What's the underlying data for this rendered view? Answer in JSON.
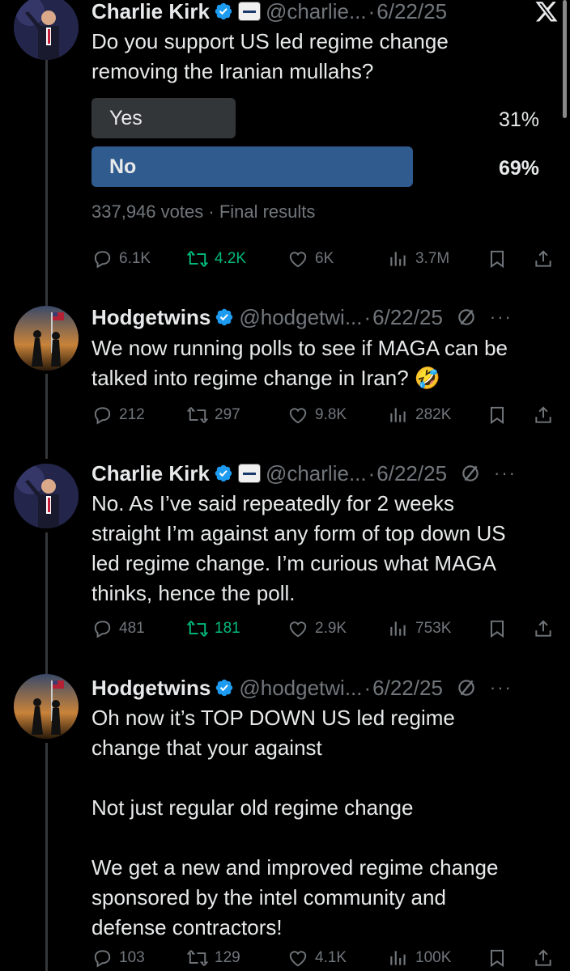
{
  "tweets": [
    {
      "name": "Charlie Kirk",
      "handle": "@charlie...",
      "sep": "·",
      "date": "6/22/25",
      "text": "Do you support US led regime change\nremoving the Iranian mullahs?",
      "poll": {
        "options": [
          {
            "label": "Yes",
            "percent_text": "31%",
            "percent": 31
          },
          {
            "label": "No",
            "percent_text": "69%",
            "percent": 69
          }
        ],
        "votes": "337,946 votes",
        "status": "Final results"
      },
      "stats": {
        "replies": "6.1K",
        "reposts": "4.2K",
        "likes": "6K",
        "views": "3.7M"
      }
    },
    {
      "name": "Hodgetwins",
      "handle": "@hodgetwi...",
      "sep": "·",
      "date": "6/22/25",
      "text": "We now running polls to see if MAGA can be\ntalked into regime change in Iran? 🤣",
      "stats": {
        "replies": "212",
        "reposts": "297",
        "likes": "9.8K",
        "views": "282K"
      }
    },
    {
      "name": "Charlie Kirk",
      "handle": "@charlie...",
      "sep": "·",
      "date": "6/22/25",
      "text": "No. As I’ve said repeatedly for 2 weeks\nstraight I’m against any form of top down US\nled regime change. I’m curious what MAGA\nthinks, hence the poll.",
      "stats": {
        "replies": "481",
        "reposts": "181",
        "likes": "2.9K",
        "views": "753K"
      }
    },
    {
      "name": "Hodgetwins",
      "handle": "@hodgetwi...",
      "sep": "·",
      "date": "6/22/25",
      "text": "Oh now it’s TOP DOWN US led regime\nchange that your against\n\nNot just regular old regime change\n\nWe get a new and improved regime change\nsponsored by the intel community and\ndefense contractors!",
      "stats": {
        "replies": "103",
        "reposts": "129",
        "likes": "4.1K",
        "views": "100K"
      }
    }
  ],
  "icons": {
    "verified": "verified-badge-icon",
    "grok": "grok-icon",
    "more": "more-icon",
    "x_logo": "x-logo-icon",
    "reply": "reply-icon",
    "repost": "repost-icon",
    "like": "like-icon",
    "views": "views-icon",
    "bookmark": "bookmark-icon",
    "share": "share-icon"
  },
  "colors": {
    "background": "#000000",
    "text": "#e7e9ea",
    "muted": "#71767b",
    "verified": "#1d9bf0",
    "reposted_green": "#00ba7c",
    "poll_winner": "#2f5b8f",
    "poll_loser": "#333639"
  }
}
